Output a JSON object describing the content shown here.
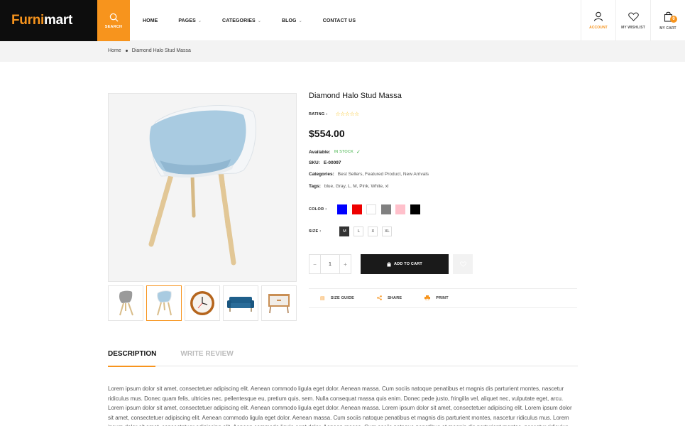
{
  "header": {
    "logo_part1": "Furni",
    "logo_part2": "mart",
    "search_label": "SEARCH",
    "nav": [
      {
        "label": "HOME",
        "dropdown": false
      },
      {
        "label": "PAGES",
        "dropdown": true
      },
      {
        "label": "CATEGORIES",
        "dropdown": true
      },
      {
        "label": "BLOG",
        "dropdown": true
      },
      {
        "label": "CONTACT US",
        "dropdown": false
      }
    ],
    "icons": [
      {
        "label": "ACCOUNT",
        "icon": "user-icon"
      },
      {
        "label": "MY WISHLIST",
        "icon": "heart-icon"
      },
      {
        "label": "MY CART",
        "icon": "bag-icon",
        "badge": "0"
      }
    ],
    "accent": "#f7941d"
  },
  "breadcrumb": {
    "home": "Home",
    "current": "Diamond Halo Stud Massa"
  },
  "product": {
    "title": "Diamond Halo Stud Massa",
    "rating_label": "RATING :",
    "rating": 0,
    "price": "$554.00",
    "available_label": "Available:",
    "available_value": "IN STOCK",
    "sku_label": "SKU:",
    "sku_value": "E-00097",
    "categories_label": "Categories:",
    "categories_value": "Best Sellers, Featured Product, New Arrivals",
    "tags_label": "Tags:",
    "tags_value": "blue, Gray, L, M, Pink, White, xl",
    "color_label": "COLOR :",
    "colors": [
      "#0000ff",
      "#ee0000",
      "#ffffff",
      "#808080",
      "#ffc0cb",
      "#000000"
    ],
    "size_label": "SIZE :",
    "sizes": [
      "M",
      "L",
      "X",
      "XL"
    ],
    "selected_size": "M",
    "quantity": "1",
    "qty_minus": "−",
    "qty_plus": "+",
    "add_to_cart": "ADD TO CART",
    "actions": [
      {
        "label": "SIZE GUIDE",
        "icon": "ruler-icon"
      },
      {
        "label": "SHARE",
        "icon": "share-icon"
      },
      {
        "label": "PRINT",
        "icon": "print-icon"
      }
    ]
  },
  "tabs": {
    "description": "DESCRIPTION",
    "write_review": "WRITE REVIEW"
  },
  "description_text": "Lorem ipsum dolor sit amet, consectetuer adipiscing elit. Aenean commodo ligula eget dolor. Aenean massa. Cum sociis natoque penatibus et magnis dis parturient montes, nascetur ridiculus mus. Donec quam felis, ultricies nec, pellentesque eu, pretium quis, sem. Nulla consequat massa quis enim. Donec pede justo, fringilla vel, aliquet nec, vulputate eget, arcu. Lorem ipsum dolor sit amet, consectetuer adipiscing elit. Aenean commodo ligula eget dolor. Aenean massa. Lorem ipsum dolor sit amet, consectetuer adipiscing elit. Lorem ipsum dolor sit amet, consectetuer adipiscing elit. Aenean commodo ligula eget dolor. Aenean massa. Cum sociis natoque penatibus et magnis dis parturient montes, nascetur ridiculus mus. Lorem ipsum dolor sit amet, consectetuer adipiscing elit. Aenean commodo ligula eget dolor. Aenean massa. Cum sociis natoque penatibus et magnis dis parturient montes, nascetur ridiculus mus."
}
